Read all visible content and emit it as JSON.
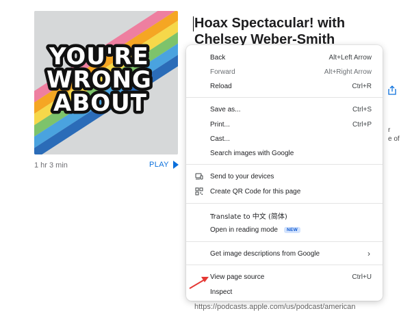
{
  "episode": {
    "title": "Hoax Spectacular! with Chelsey Weber-Smith",
    "duration": "1 hr 3 min",
    "play_label": "PLAY",
    "edge_text_1": "r",
    "edge_text_2": "e of",
    "url_peek": "https://podcasts.apple.com/us/podcast/american"
  },
  "artwork": {
    "line1": "YOU'RE",
    "line2": "WRONG",
    "line3": "ABOUT",
    "stripe_colors": [
      "#ee7fa0",
      "#f5a623",
      "#f6d84a",
      "#7dc36b",
      "#4aa3df",
      "#2b6cb8"
    ],
    "background": "#d6d8d9"
  },
  "context_menu": {
    "back": {
      "label": "Back",
      "shortcut": "Alt+Left Arrow"
    },
    "forward": {
      "label": "Forward",
      "shortcut": "Alt+Right Arrow"
    },
    "reload": {
      "label": "Reload",
      "shortcut": "Ctrl+R"
    },
    "save_as": {
      "label": "Save as...",
      "shortcut": "Ctrl+S"
    },
    "print": {
      "label": "Print...",
      "shortcut": "Ctrl+P"
    },
    "cast": {
      "label": "Cast..."
    },
    "search_images": {
      "label": "Search images with Google"
    },
    "send_devices": {
      "label": "Send to your devices",
      "icon": "devices-icon"
    },
    "qr_code": {
      "label": "Create QR Code for this page",
      "icon": "qr-code-icon"
    },
    "translate": {
      "label": "Translate to 中文 (简体)"
    },
    "reading_mode": {
      "label": "Open in reading mode",
      "badge": "NEW"
    },
    "image_descriptions": {
      "label": "Get image descriptions from Google"
    },
    "view_source": {
      "label": "View page source",
      "shortcut": "Ctrl+U"
    },
    "inspect": {
      "label": "Inspect"
    }
  },
  "annotation": {
    "arrow_color": "#e53935"
  }
}
